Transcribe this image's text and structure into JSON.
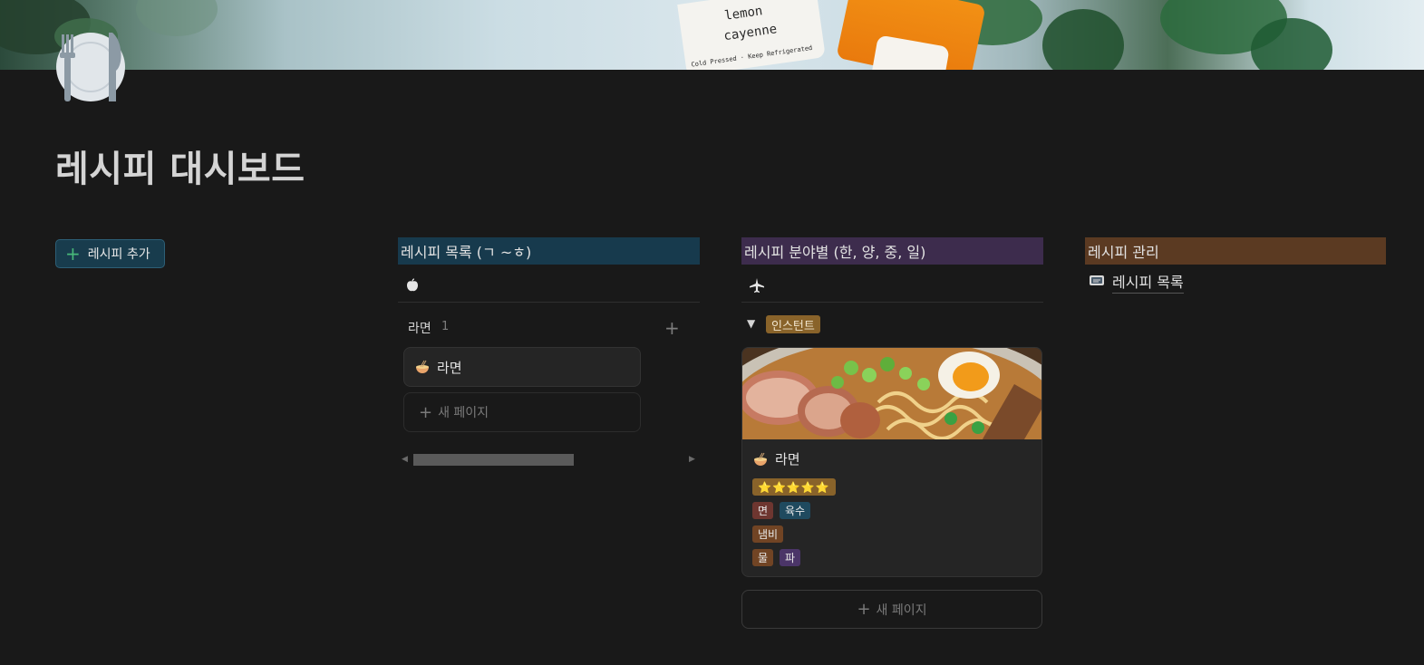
{
  "cover": {
    "label_line1": "lemon",
    "label_line2": "cayenne",
    "label_small": "Cold Pressed · Keep Refrigerated"
  },
  "page": {
    "title": "레시피 대시보드",
    "icon": "plate-fork-knife-icon"
  },
  "add_button": {
    "label": "레시피 추가"
  },
  "columns": {
    "list": {
      "header": "레시피 목록 (ㄱ ~ㅎ)",
      "view_icon": "apple-icon",
      "group": {
        "label": "라면",
        "count": "1"
      },
      "card": {
        "title": "라면",
        "icon": "ramen-icon"
      },
      "new_page": "새 페이지"
    },
    "category": {
      "header": "레시피 분야별 (한, 양, 중, 일)",
      "view_icon": "airplane-icon",
      "group_tag": "인스턴트",
      "card": {
        "title": "라면",
        "icon": "ramen-icon",
        "rating": "⭐⭐⭐⭐⭐",
        "tags_row1": [
          "면",
          "육수"
        ],
        "tags_row2": [
          "냄비"
        ],
        "tags_row3": [
          "물",
          "파"
        ]
      },
      "new_page": "새 페이지"
    },
    "manage": {
      "header": "레시피 관리",
      "link": {
        "label": "레시피 목록",
        "icon": "cookbook-icon"
      }
    }
  },
  "colors": {
    "background": "#191919",
    "header_blue": "#173a4d",
    "header_purple": "#3d2c4d",
    "header_brown": "#5b3a22",
    "accent_green": "#48b97a"
  }
}
